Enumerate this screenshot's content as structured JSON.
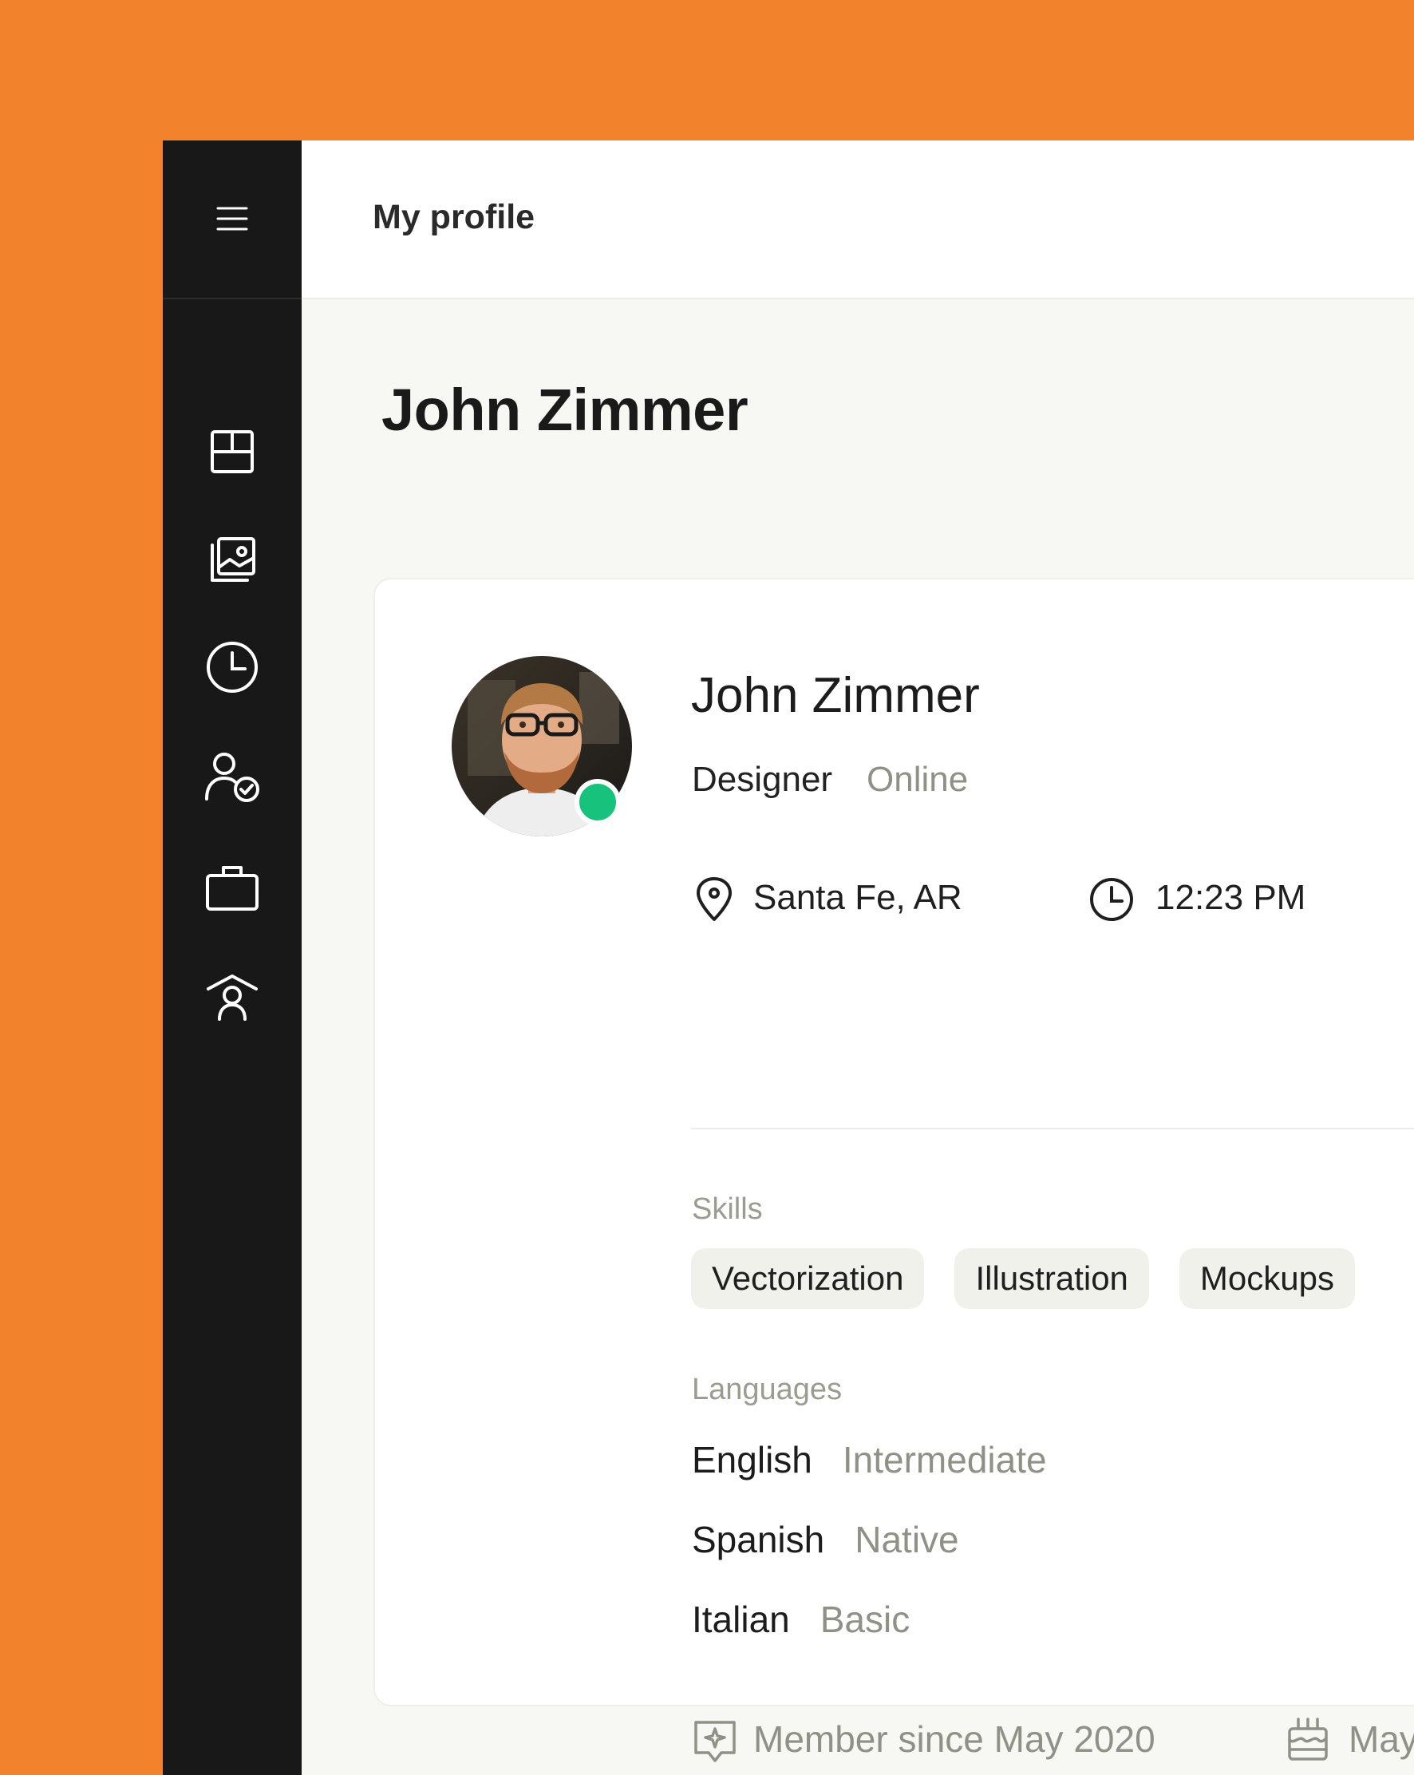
{
  "topbar": {
    "title": "My profile"
  },
  "page": {
    "title": "John Zimmer"
  },
  "sidebar": {
    "items": [
      {
        "icon": "menu-icon"
      },
      {
        "icon": "dashboard-icon"
      },
      {
        "icon": "gallery-icon"
      },
      {
        "icon": "clock-icon"
      },
      {
        "icon": "verified-user-icon"
      },
      {
        "icon": "briefcase-icon"
      },
      {
        "icon": "team-icon"
      }
    ]
  },
  "profile": {
    "name": "John Zimmer",
    "role": "Designer",
    "status": "Online",
    "status_color": "#17C27C",
    "location": "Santa Fe, AR",
    "local_time": "12:23 PM"
  },
  "skills": {
    "label": "Skills",
    "items": [
      "Vectorization",
      "Illustration",
      "Mockups"
    ]
  },
  "languages": {
    "label": "Languages",
    "items": [
      {
        "name": "English",
        "level": "Intermediate"
      },
      {
        "name": "Spanish",
        "level": "Native"
      },
      {
        "name": "Italian",
        "level": "Basic"
      }
    ]
  },
  "footer": {
    "member_since": "Member since May 2020",
    "birthday": "May"
  },
  "colors": {
    "accent_background": "#F2832C",
    "sidebar": "#181818"
  }
}
